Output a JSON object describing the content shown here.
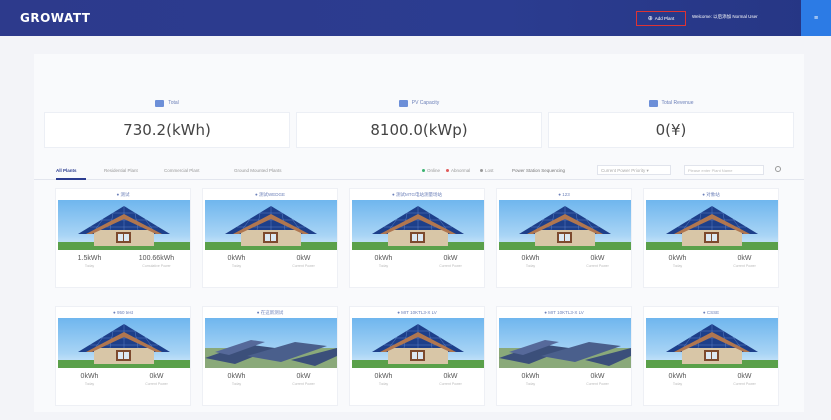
{
  "header": {
    "logo": "GROWATT",
    "add_plant": "Add Plant",
    "welcome": "Welcome: 以后添加 Normal User",
    "corner_icon": "menu-icon"
  },
  "stats": [
    {
      "label": "Total",
      "value": "730.2(kWh)",
      "icon": "energy-icon"
    },
    {
      "label": "PV Capacity",
      "value": "8100.0(kWp)",
      "icon": "solar-panel-icon"
    },
    {
      "label": "Total Revenue",
      "value": "0(¥)",
      "icon": "revenue-icon"
    }
  ],
  "filters": {
    "tabs": [
      "All Plants",
      "Residential Plant",
      "Commercial Plant",
      "Ground Mounted Plants"
    ],
    "legend": [
      {
        "label": "Online",
        "color": "#3cb371"
      },
      {
        "label": "Abnormal",
        "color": "#e05a5a"
      },
      {
        "label": "Lost",
        "color": "#999999"
      }
    ],
    "sort_label": "Power Station Sequencing",
    "sort_value": "Current Power Priority",
    "search_placeholder": "Please enter Plant Name"
  },
  "plants": [
    {
      "name": "● 测试",
      "image": "house",
      "power": "1.5kWh",
      "power_cap": "Today",
      "energy": "100.66kWh",
      "energy_cap": "Cumulative Power"
    },
    {
      "name": "● 测试WEDGE",
      "image": "house",
      "power": "0kWh",
      "power_cap": "Today",
      "energy": "0kW",
      "energy_cap": "Current Power"
    },
    {
      "name": "● 测试MTG电站测量场站",
      "image": "house",
      "power": "0kWh",
      "power_cap": "Today",
      "energy": "0kW",
      "energy_cap": "Current Power"
    },
    {
      "name": "● 123",
      "image": "house",
      "power": "0kWh",
      "power_cap": "Today",
      "energy": "0kW",
      "energy_cap": "Current Power"
    },
    {
      "name": "● 对象站",
      "image": "house",
      "power": "0kWh",
      "power_cap": "Today",
      "energy": "0kW",
      "energy_cap": "Current Power"
    },
    {
      "name": "● 950 test",
      "image": "house",
      "power": "0kWh",
      "power_cap": "Today",
      "energy": "0kW",
      "energy_cap": "Current Power"
    },
    {
      "name": "● 在这新测试",
      "image": "field",
      "power": "0kWh",
      "power_cap": "Today",
      "energy": "0kW",
      "energy_cap": "Current Power"
    },
    {
      "name": "● MIT 10KTL3-X LV",
      "image": "house",
      "power": "0kWh",
      "power_cap": "Today",
      "energy": "0kW",
      "energy_cap": "Current Power"
    },
    {
      "name": "● MIT 10KTL3-X LV",
      "image": "field",
      "power": "0kWh",
      "power_cap": "Today",
      "energy": "0kW",
      "energy_cap": "Current Power"
    },
    {
      "name": "● CSSE",
      "image": "house",
      "power": "0kWh",
      "power_cap": "Today",
      "energy": "0kW",
      "energy_cap": "Current Power"
    }
  ]
}
